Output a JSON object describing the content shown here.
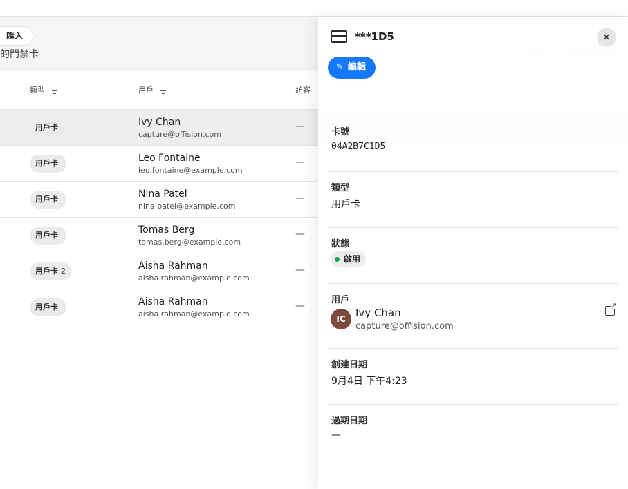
{
  "header": {
    "import_label": "匯入",
    "subtitle": "的門禁卡"
  },
  "table": {
    "columns": {
      "type": "類型",
      "user": "用戶",
      "visitor": "訪客"
    },
    "rows": [
      {
        "type": "用戶卡",
        "count": "",
        "name": "Ivy Chan",
        "email": "capture@offision.com",
        "visitor": "—"
      },
      {
        "type": "用戶卡",
        "count": "",
        "name": "Leo Fontaine",
        "email": "leo.fontaine@example.com",
        "visitor": "—"
      },
      {
        "type": "用戶卡",
        "count": "",
        "name": "Nina Patel",
        "email": "nina.patel@example.com",
        "visitor": "—"
      },
      {
        "type": "用戶卡",
        "count": "",
        "name": "Tomas Berg",
        "email": "tomas.berg@example.com",
        "visitor": "—"
      },
      {
        "type": "用戶卡",
        "count": "2",
        "name": "Aisha Rahman",
        "email": "aisha.rahman@example.com",
        "visitor": "—"
      },
      {
        "type": "用戶卡",
        "count": "",
        "name": "Aisha Rahman",
        "email": "aisha.rahman@example.com",
        "visitor": "—"
      }
    ]
  },
  "panel": {
    "title": "***1D5",
    "close_glyph": "✕",
    "edit_label": "編輯",
    "card_number_label": "卡號",
    "card_number": "04A2B7C1D5",
    "type_label": "類型",
    "type_value": "用戶卡",
    "status_label": "狀態",
    "status_value": "啟用",
    "status_color": "#16a34a",
    "user_label": "用戶",
    "user_initials": "IC",
    "user_name": "Ivy Chan",
    "user_email": "capture@offision.com",
    "created_label": "創建日期",
    "created_value": "9月4日 下午4:23",
    "expiry_label": "過期日期",
    "expiry_value": "—"
  },
  "icons": {
    "card": "credit-card-icon",
    "edit": "pencil-icon",
    "close": "close-icon",
    "external": "external-link-icon",
    "filter": "filter-icon"
  },
  "colors": {
    "accent": "#1677ff",
    "avatar": "#7d4a3d",
    "selected_row": "#eeeeef"
  }
}
